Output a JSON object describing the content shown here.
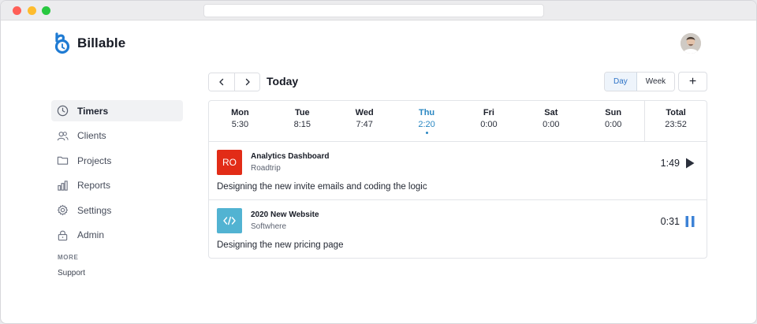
{
  "app": {
    "name": "Billable"
  },
  "colors": {
    "accent": "#2f74c7",
    "active_day": "#2a87c2",
    "ro_badge": "#e22c17",
    "web_badge": "#52b3d2"
  },
  "sidebar": {
    "items": [
      {
        "label": "Timers",
        "icon": "clock-icon",
        "active": true
      },
      {
        "label": "Clients",
        "icon": "users-icon"
      },
      {
        "label": "Projects",
        "icon": "folder-icon"
      },
      {
        "label": "Reports",
        "icon": "bar-chart-icon"
      },
      {
        "label": "Settings",
        "icon": "gear-icon"
      },
      {
        "label": "Admin",
        "icon": "lock-icon"
      }
    ],
    "section_label": "MORE",
    "support_label": "Support"
  },
  "toolbar": {
    "prev_icon": "chevron-left-icon",
    "next_icon": "chevron-right-icon",
    "title": "Today",
    "view_day": "Day",
    "view_week": "Week",
    "add_label": "+"
  },
  "week": [
    {
      "day": "Mon",
      "value": "5:30"
    },
    {
      "day": "Tue",
      "value": "8:15"
    },
    {
      "day": "Wed",
      "value": "7:47"
    },
    {
      "day": "Thu",
      "value": "2:20",
      "active": true
    },
    {
      "day": "Fri",
      "value": "0:00"
    },
    {
      "day": "Sat",
      "value": "0:00"
    },
    {
      "day": "Sun",
      "value": "0:00"
    }
  ],
  "total": {
    "label": "Total",
    "value": "23:52"
  },
  "entries": [
    {
      "badge": "RO",
      "project": "Analytics Dashboard",
      "client": "Roadtrip",
      "description": "Designing the new invite emails and coding the logic",
      "time": "1:49",
      "action_icon": "play-icon"
    },
    {
      "badge_icon": "code-icon",
      "project": "2020 New Website",
      "client": "Softwhere",
      "description": "Designing the new pricing page",
      "time": "0:31",
      "action_icon": "pause-icon"
    }
  ]
}
